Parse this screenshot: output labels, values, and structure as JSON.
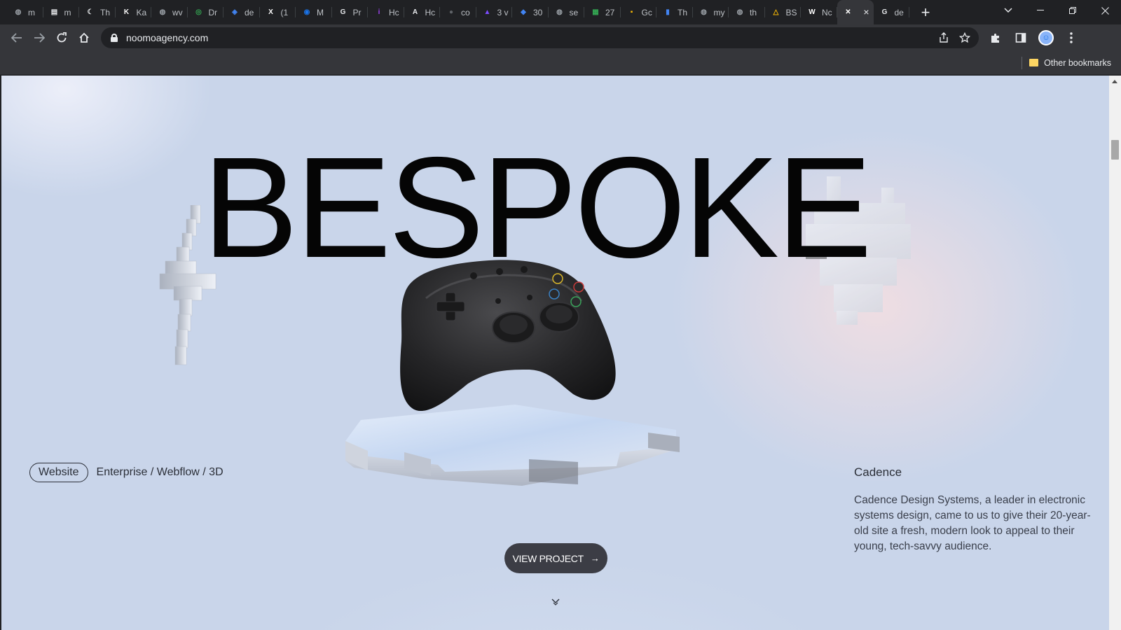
{
  "browser": {
    "tabs": [
      {
        "label": "m",
        "icon": "globe-icon",
        "color": "#9aa0a6"
      },
      {
        "label": "m",
        "icon": "page-icon",
        "color": "#e8eaed"
      },
      {
        "label": "Th",
        "icon": "moon-icon",
        "color": "#e8eaed"
      },
      {
        "label": "Ka",
        "icon": "k-logo-icon",
        "color": "#ffffff"
      },
      {
        "label": "wv",
        "icon": "globe-icon",
        "color": "#9aa0a6"
      },
      {
        "label": "Dr",
        "icon": "fingerprint-icon",
        "color": "#34a853"
      },
      {
        "label": "de",
        "icon": "robot-icon",
        "color": "#4285f4"
      },
      {
        "label": "(1",
        "icon": "x-logo-icon",
        "color": "#ffffff"
      },
      {
        "label": "M",
        "icon": "search-logo-icon",
        "color": "#1a73e8"
      },
      {
        "label": "Pr",
        "icon": "google-icon",
        "color": "#e8eaed"
      },
      {
        "label": "Hc",
        "icon": "info-icon",
        "color": "#a142f4"
      },
      {
        "label": "Hc",
        "icon": "a-logo-icon",
        "color": "#e8eaed"
      },
      {
        "label": "co",
        "icon": "github-icon",
        "color": "#5f6368"
      },
      {
        "label": "3 v",
        "icon": "rocket-icon",
        "color": "#7c4dff"
      },
      {
        "label": "30",
        "icon": "diamond-icon",
        "color": "#4285f4"
      },
      {
        "label": "se",
        "icon": "globe-icon",
        "color": "#9aa0a6"
      },
      {
        "label": "27",
        "icon": "sheet-icon",
        "color": "#34a853"
      },
      {
        "label": "Gc",
        "icon": "keep-icon",
        "color": "#fbbc04"
      },
      {
        "label": "Th",
        "icon": "book-icon",
        "color": "#4285f4"
      },
      {
        "label": "my",
        "icon": "globe-icon",
        "color": "#9aa0a6"
      },
      {
        "label": "th",
        "icon": "globe-icon",
        "color": "#9aa0a6"
      },
      {
        "label": "BS",
        "icon": "drive-icon",
        "color": "#fbbc04"
      },
      {
        "label": "Nc",
        "icon": "w-logo-icon",
        "color": "#ffffff"
      },
      {
        "label": "",
        "icon": "noomo-icon",
        "color": "#ffffff",
        "active": true
      },
      {
        "label": "de",
        "icon": "google-icon",
        "color": "#e8eaed"
      }
    ],
    "url": "noomoagency.com",
    "bookmarks_label": "Other bookmarks"
  },
  "page": {
    "hero_title": "BESPOKE",
    "tag_pill": "Website",
    "tag_text": "Enterprise / Webflow / 3D",
    "project_title": "Cadence",
    "project_desc": "Cadence Design Systems, a leader in electronic systems design, came to us to give their 20-year-old site a fresh, modern look to appeal to their young, tech-savvy audience.",
    "cta_label": "VIEW PROJECT",
    "cta_arrow": "→"
  }
}
